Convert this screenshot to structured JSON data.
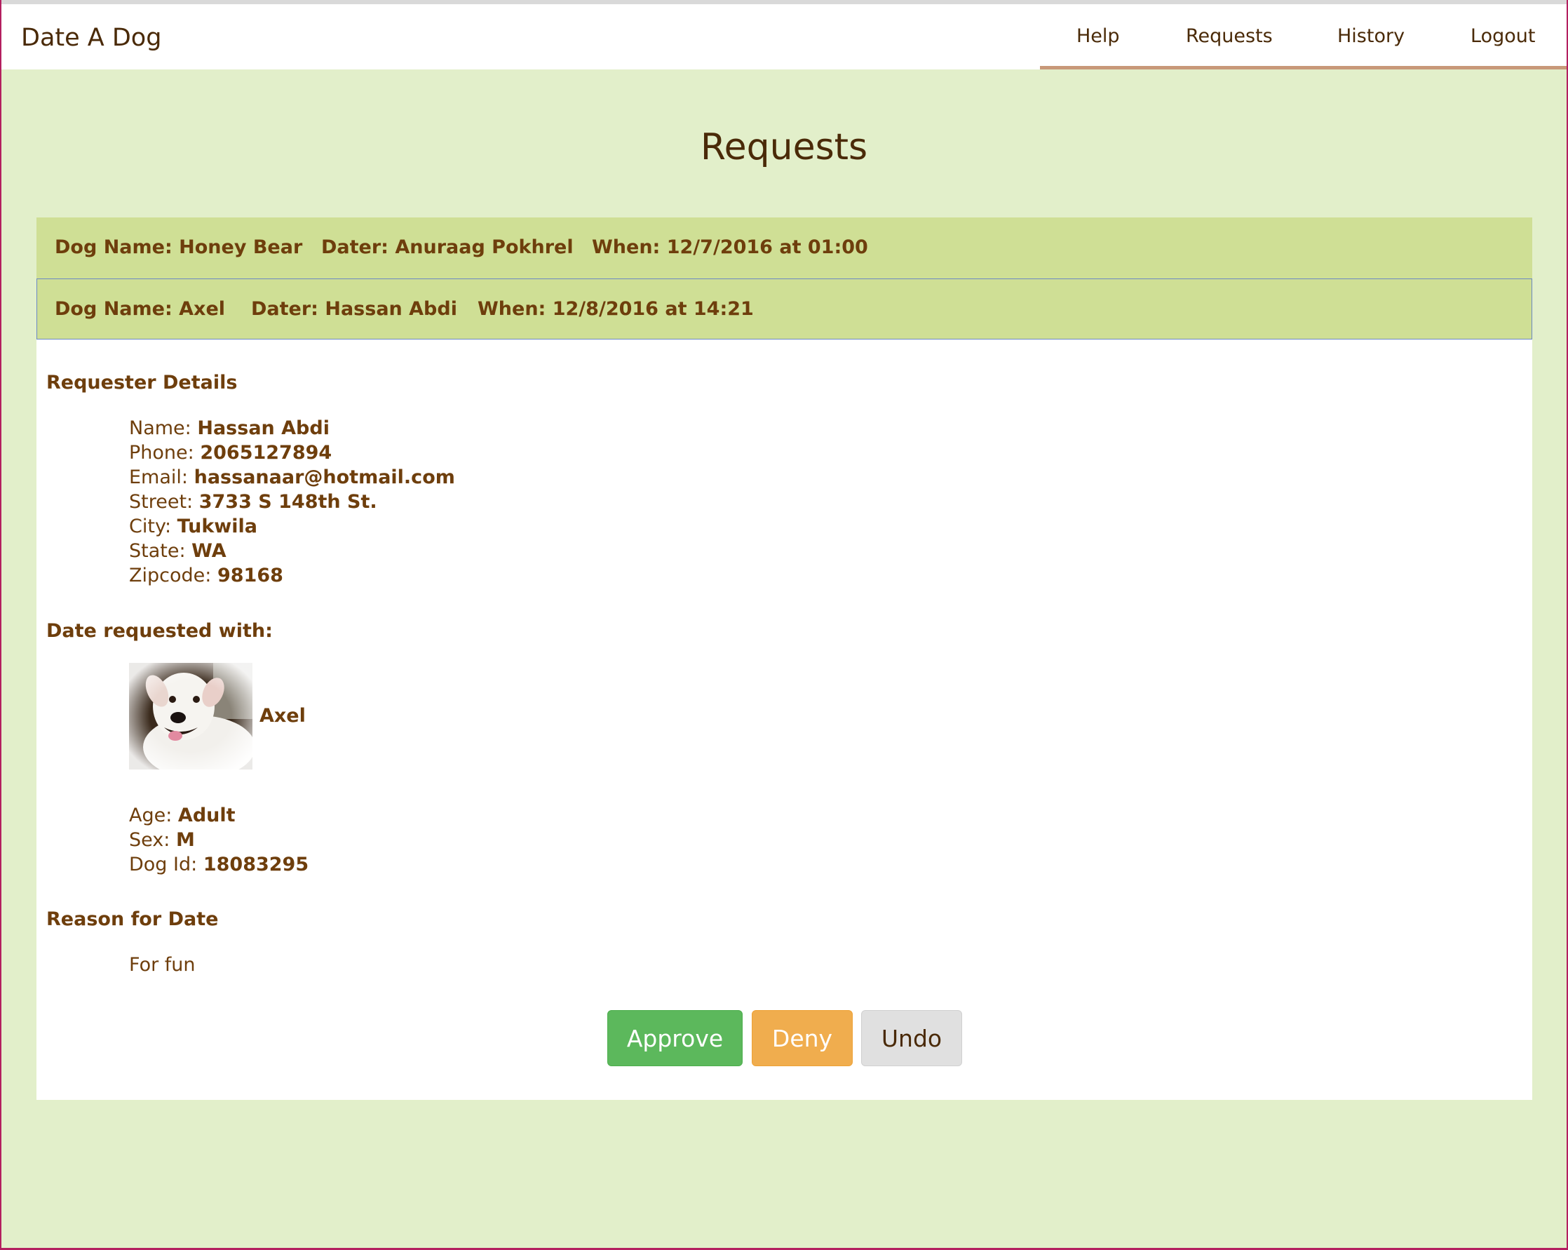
{
  "app": {
    "title": "Date A Dog"
  },
  "nav": {
    "items": [
      {
        "label": "Help"
      },
      {
        "label": "Requests"
      },
      {
        "label": "History"
      },
      {
        "label": "Logout"
      }
    ]
  },
  "page": {
    "title": "Requests"
  },
  "requests": [
    {
      "dog_name": "Dog Name: Honey Bear",
      "dater": "Dater: Anuraag Pokhrel",
      "when": "When: 12/7/2016 at 01:00"
    },
    {
      "dog_name": "Dog Name: Axel",
      "dater": "Dater: Hassan Abdi",
      "when": "When: 12/8/2016 at 14:21"
    }
  ],
  "details": {
    "requester_heading": "Requester Details",
    "requester": [
      {
        "label": "Name:",
        "value": "Hassan Abdi"
      },
      {
        "label": "Phone:",
        "value": "2065127894"
      },
      {
        "label": "Email:",
        "value": "hassanaar@hotmail.com"
      },
      {
        "label": "Street:",
        "value": "3733 S 148th St."
      },
      {
        "label": "City:",
        "value": "Tukwila"
      },
      {
        "label": "State:",
        "value": "WA"
      },
      {
        "label": "Zipcode:",
        "value": "98168"
      }
    ],
    "date_heading": "Date requested with:",
    "dog": {
      "name": "Axel",
      "fields": [
        {
          "label": "Age:",
          "value": "Adult"
        },
        {
          "label": "Sex:",
          "value": "M"
        },
        {
          "label": "Dog Id:",
          "value": "18083295"
        }
      ]
    },
    "reason_heading": "Reason for Date",
    "reason": "For fun"
  },
  "actions": {
    "approve": "Approve",
    "deny": "Deny",
    "undo": "Undo"
  },
  "colors": {
    "page_bg": "#e2efca",
    "row_bg": "#cfdf95",
    "text_brown": "#6e3e0c",
    "approve": "#5cb85c",
    "deny": "#f0ad4e",
    "undo": "#e0e0e0",
    "nav_underline": "#c89879"
  }
}
